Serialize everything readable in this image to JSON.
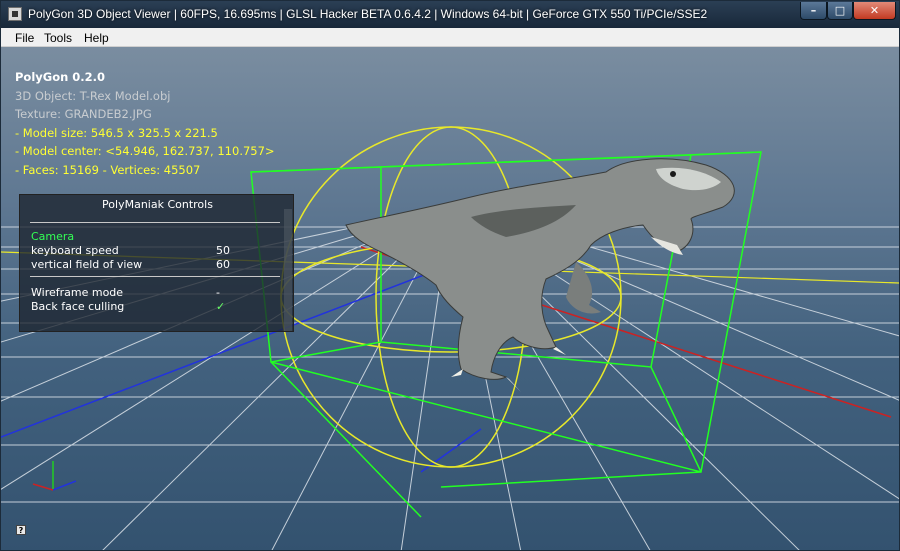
{
  "window": {
    "title": "PolyGon 3D Object Viewer | 60FPS, 16.695ms | GLSL Hacker BETA 0.6.4.2 | Windows 64-bit | GeForce GTX 550 Ti/PCIe/SSE2",
    "controls": {
      "minimize": "–",
      "maximize": "□",
      "close": "✕"
    }
  },
  "menu": [
    "File",
    "Tools",
    "Help"
  ],
  "info": {
    "app": "PolyGon 0.2.0",
    "object": "3D Object: T-Rex Model.obj",
    "texture": "Texture: GRANDEB2.JPG",
    "model_size": "- Model size:  546.5 x 325.5 x 221.5",
    "model_center": "- Model center:  <54.946, 162.737, 110.757>",
    "faces_vertices": "- Faces: 15169 - Vertices: 45507"
  },
  "panel": {
    "title": "PolyManiak Controls",
    "section": "Camera",
    "keyboard_speed_label": "keyboard speed",
    "keyboard_speed_value": "50",
    "fov_label": "vertical field of view",
    "fov_value": "60",
    "wireframe_label": "Wireframe mode",
    "wireframe_value": "-",
    "culling_label": "Back face culling",
    "culling_value": "✓"
  },
  "help_icon": "?",
  "colors": {
    "info_yellow": "#ffff33",
    "section_green": "#33ff55",
    "bbox_green": "#22ff22",
    "sphere_yellow": "#e8e82a",
    "axis_red": "#cc2222",
    "axis_blue": "#2233dd"
  }
}
